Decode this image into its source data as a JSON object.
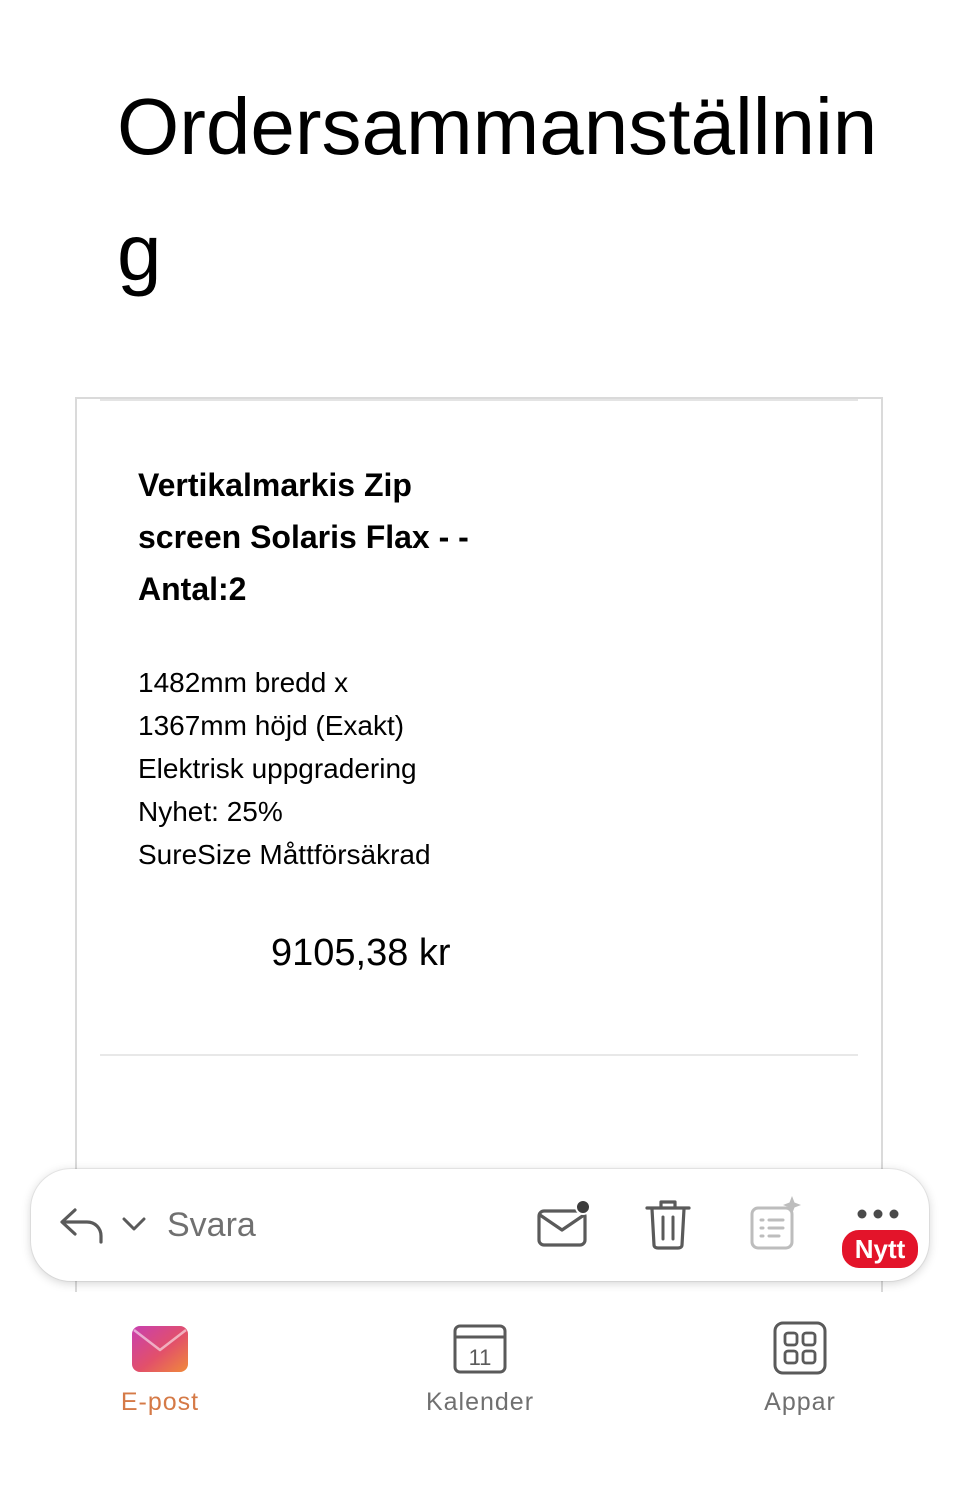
{
  "email": {
    "title": "Ordersammanställning",
    "product": {
      "name": "Vertikalmarkis Zip screen Solaris Flax - -Antal:2",
      "specs": [
        "1482mm bredd x",
        "1367mm höjd (Exakt)",
        "Elektrisk uppgradering",
        "Nyhet: 25%",
        "SureSize Måttförsäkrad"
      ],
      "price": "9105,38 kr"
    }
  },
  "action_bar": {
    "reply_icon": "reply-icon",
    "chevron_icon": "chevron-down-icon",
    "reply_label": "Svara",
    "mark_unread_icon": "mail-unread-icon",
    "delete_icon": "trash-icon",
    "ai_icon": "ai-summary-icon",
    "more_icon": "more-icon",
    "new_badge": "Nytt"
  },
  "tabs": [
    {
      "label": "E-post",
      "icon": "mail-icon",
      "active": true
    },
    {
      "label": "Kalender",
      "icon": "calendar-icon",
      "calendar_day": "11",
      "active": false
    },
    {
      "label": "Appar",
      "icon": "apps-grid-icon",
      "active": false
    }
  ],
  "colors": {
    "accent": "#d57a47",
    "badge": "#e3142a",
    "muted": "#707070"
  }
}
